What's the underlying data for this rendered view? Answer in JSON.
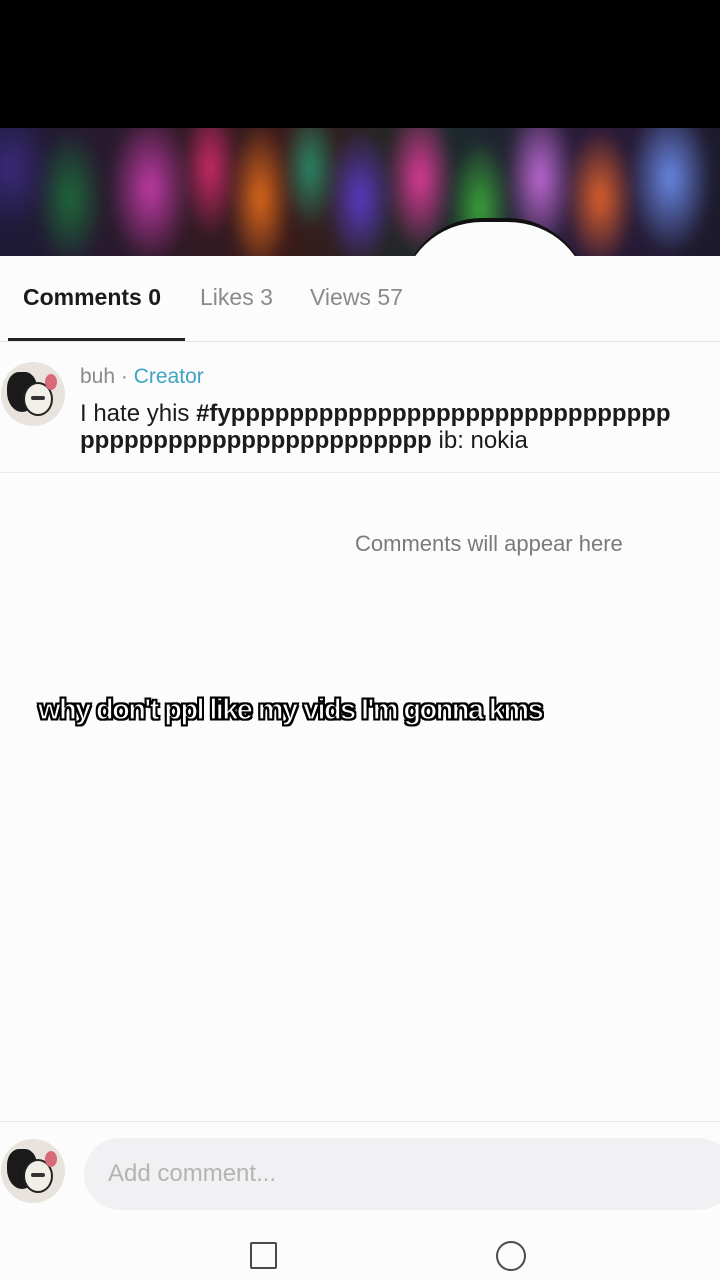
{
  "tabs": [
    {
      "label": "Comments 0",
      "active": true
    },
    {
      "label": "Likes 3",
      "active": false
    },
    {
      "label": "Views 57",
      "active": false
    }
  ],
  "caption_comment": {
    "author": "buh",
    "separator": " · ",
    "badge": "Creator",
    "text_prefix": "I hate yhis ",
    "hashtag": "#fypppppppppppppppppppppppppppppppppppppppppppppppppppppp",
    "text_suffix": " ib: nokia"
  },
  "empty_state": "Comments will appear here",
  "overlay_caption": "why don't ppl like my vids I'm gonna kms",
  "composer": {
    "placeholder": "Add comment..."
  },
  "colors": {
    "accent_badge": "#3ea3c4",
    "active_tab": "#1b1b1b",
    "inactive_tab": "#8a8a8a"
  },
  "icons": {
    "nav_recents": "square-icon",
    "nav_home": "circle-icon"
  }
}
